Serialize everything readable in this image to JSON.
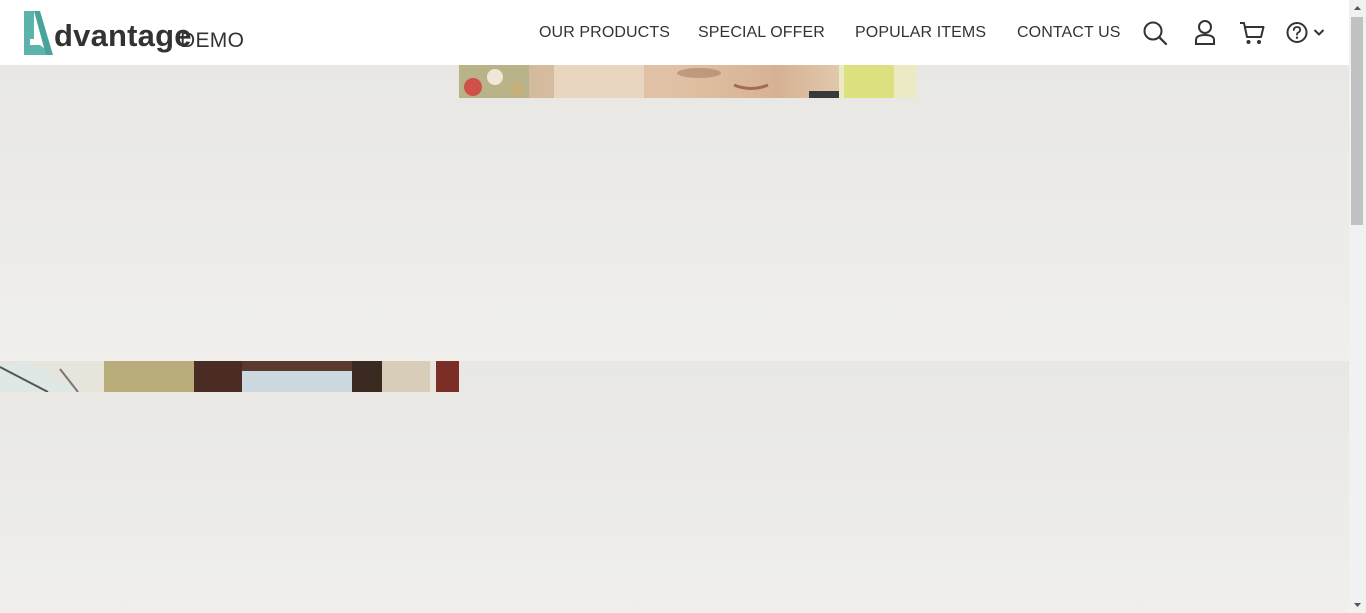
{
  "brand": {
    "word": "dvantage",
    "suffix": "DEMO",
    "accent_color": "#5ab4ac"
  },
  "nav": {
    "items": [
      {
        "label": "OUR PRODUCTS"
      },
      {
        "label": "SPECIAL OFFER"
      },
      {
        "label": "POPULAR ITEMS"
      },
      {
        "label": "CONTACT US"
      }
    ]
  },
  "icons": {
    "search": "search-icon",
    "user": "user-icon",
    "cart": "cart-icon",
    "help": "help-icon",
    "chevron": "chevron-down-icon"
  },
  "colors": {
    "header_bg": "#ffffff",
    "page_bg": "#e9e8e4",
    "text": "#333333"
  }
}
